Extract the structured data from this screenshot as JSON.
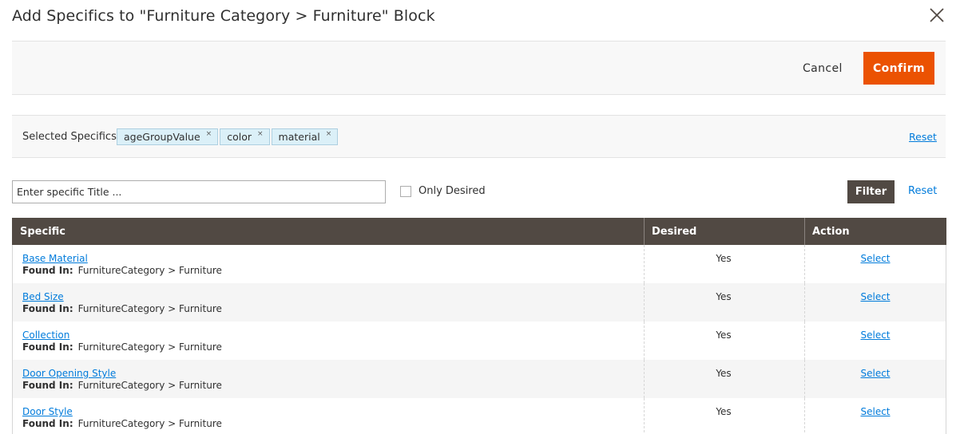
{
  "modal": {
    "title": "Add Specifics to \"Furniture Category > Furniture\" Block"
  },
  "actions": {
    "cancel_label": "Cancel",
    "confirm_label": "Confirm"
  },
  "selected": {
    "label": "Selected Specifics",
    "chips": [
      "ageGroupValue",
      "color",
      "material"
    ],
    "chip_remove_glyph": "×",
    "reset_label": "Reset"
  },
  "filter": {
    "search_placeholder": "Enter specific Title ...",
    "search_value": "",
    "only_desired_label": "Only Desired",
    "only_desired_checked": false,
    "filter_label": "Filter",
    "reset_label": "Reset"
  },
  "grid": {
    "columns": [
      "Specific",
      "Desired",
      "Action"
    ],
    "found_in_label": "Found In:",
    "rows": [
      {
        "specific": "Base Material",
        "found_in": "FurnitureCategory > Furniture",
        "desired": "Yes",
        "action": "Select"
      },
      {
        "specific": "Bed Size",
        "found_in": "FurnitureCategory > Furniture",
        "desired": "Yes",
        "action": "Select"
      },
      {
        "specific": "Collection",
        "found_in": "FurnitureCategory > Furniture",
        "desired": "Yes",
        "action": "Select"
      },
      {
        "specific": "Door Opening Style",
        "found_in": "FurnitureCategory > Furniture",
        "desired": "Yes",
        "action": "Select"
      },
      {
        "specific": "Door Style",
        "found_in": "FurnitureCategory > Furniture",
        "desired": "Yes",
        "action": "Select"
      }
    ]
  },
  "colors": {
    "accent": "#eb5202",
    "header_bg": "#514943",
    "link": "#007bdb",
    "chip_bg": "#dbf0f8"
  },
  "icons": {
    "close": "close-icon",
    "chip_remove": "remove-chip-icon",
    "checkbox": "checkbox-icon"
  }
}
